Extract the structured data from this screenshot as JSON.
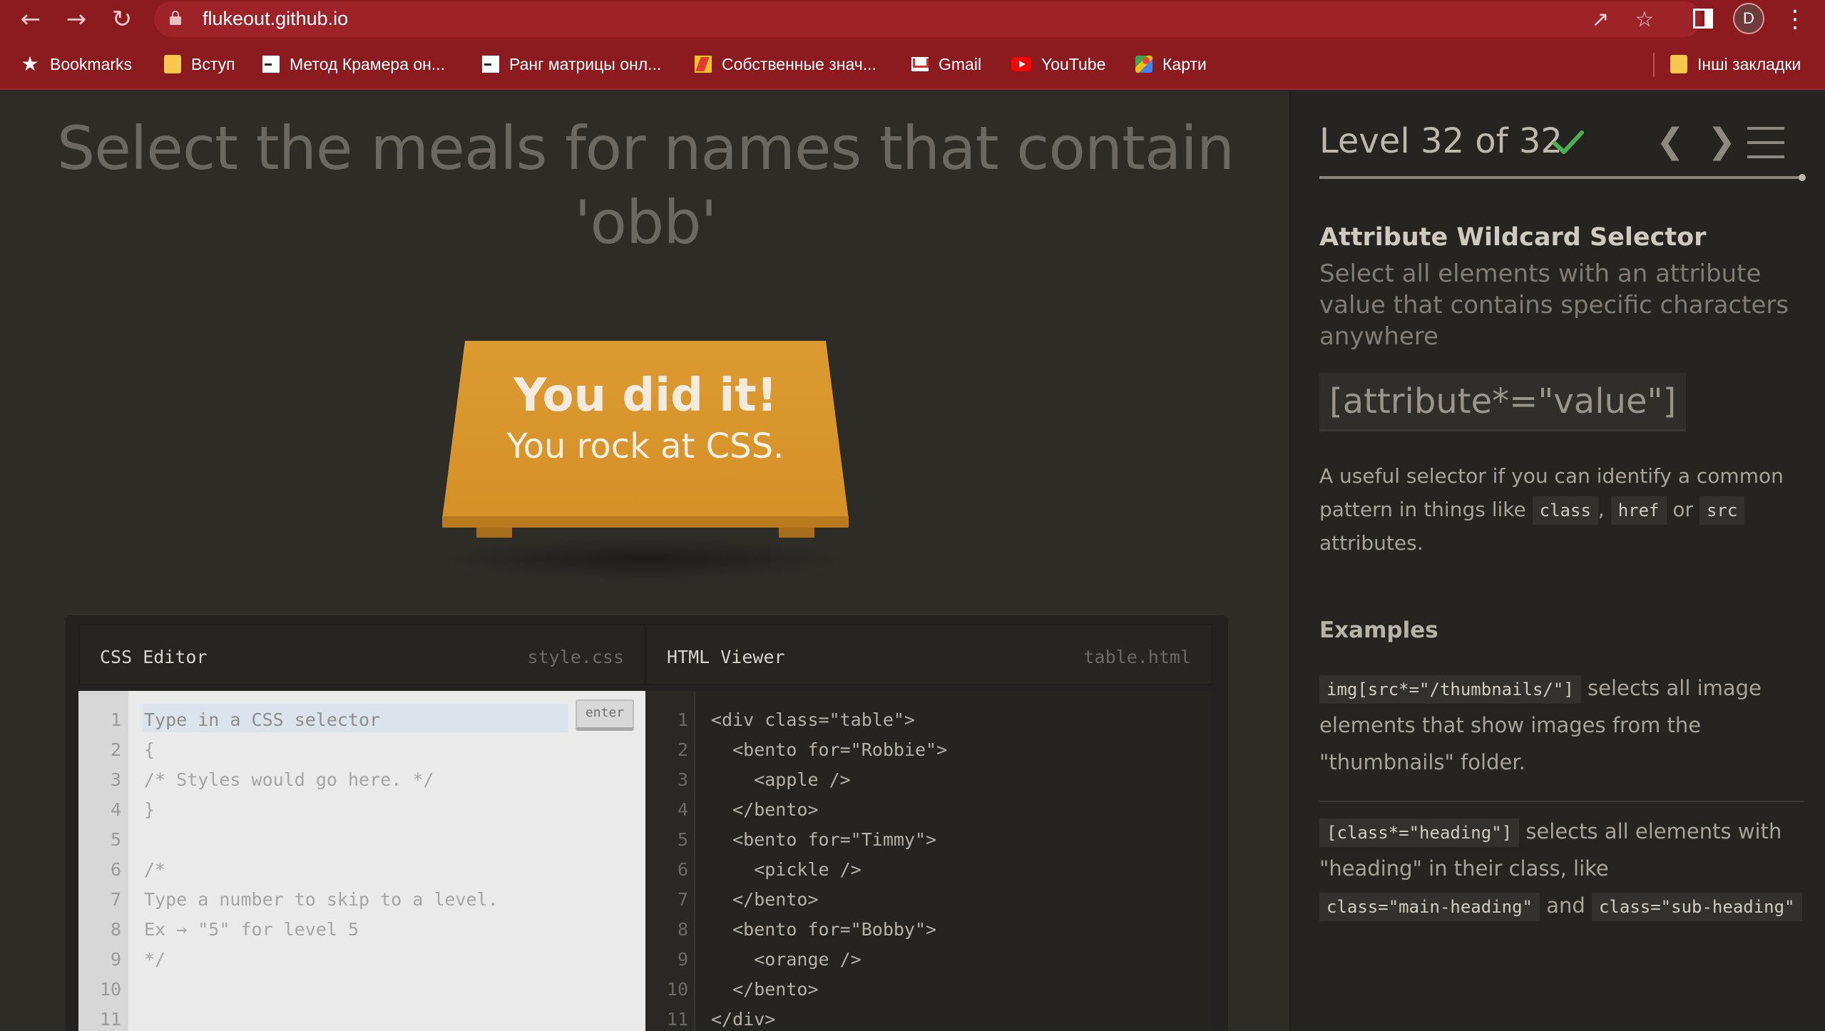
{
  "browser": {
    "url": "flukeout.github.io",
    "avatar_initial": "D",
    "bookmarks": [
      {
        "label": "Bookmarks",
        "icon": "star-icon"
      },
      {
        "label": "Вступ",
        "icon": "folder-icon"
      },
      {
        "label": "Метод Крамера он...",
        "icon": "page-icon"
      },
      {
        "label": "Ранг матрицы онл...",
        "icon": "page-icon"
      },
      {
        "label": "Собственные знач...",
        "icon": "bolt-icon"
      },
      {
        "label": "Gmail",
        "icon": "gmail-icon"
      },
      {
        "label": "YouTube",
        "icon": "youtube-icon"
      },
      {
        "label": "Карти",
        "icon": "maps-icon"
      }
    ],
    "other_bookmarks": "Інші закладки"
  },
  "game": {
    "order_line1": "Select the meals for names that contain",
    "order_line2": "'obb'",
    "win_title": "You did it!",
    "win_subtitle": "You rock at CSS."
  },
  "css_editor": {
    "title": "CSS Editor",
    "file": "style.css",
    "placeholder": "Type in a CSS selector",
    "enter_label": "enter",
    "line_numbers": [
      "1",
      "2",
      "3",
      "4",
      "5",
      "6",
      "7",
      "8",
      "9",
      "10",
      "11"
    ],
    "lines": [
      "",
      "{",
      "/* Styles would go here. */",
      "}",
      "",
      "/*",
      "Type a number to skip to a level.",
      "Ex → \"5\" for level 5",
      "*/",
      "",
      ""
    ]
  },
  "html_viewer": {
    "title": "HTML Viewer",
    "file": "table.html",
    "line_numbers": [
      "1",
      "2",
      "3",
      "4",
      "5",
      "6",
      "7",
      "8",
      "9",
      "10",
      "11"
    ],
    "lines": [
      "<div class=\"table\">",
      "  <bento for=\"Robbie\">",
      "    <apple />",
      "  </bento>",
      "  <bento for=\"Timmy\">",
      "    <pickle />",
      "  </bento>",
      "  <bento for=\"Bobby\">",
      "    <orange />",
      "  </bento>",
      "</div>"
    ]
  },
  "sidebar": {
    "level_text": "Level 32 of 32",
    "level_complete": true,
    "progress": 1.0,
    "selector_name": "Attribute Wildcard Selector",
    "selector_title": "Select all elements with an attribute value that contains specific characters anywhere",
    "syntax": "[attribute*=\"value\"]",
    "hint_part1": "A useful selector if you can identify a common pattern in things like",
    "hint_tag1": "class",
    "hint_sep1": ",",
    "hint_tag2": "href",
    "hint_or": "or",
    "hint_tag3": "src",
    "hint_part2": "attributes.",
    "examples_title": "Examples",
    "ex1_code": "img[src*=\"/thumbnails/\"]",
    "ex1_text": "selects all image elements that show images from the \"thumbnails\" folder.",
    "ex2_code": "[class*=\"heading\"]",
    "ex2_text": "selects all elements with \"heading\" in their class, like",
    "ex2_tag1": "class=\"main-heading\"",
    "ex2_and": "and",
    "ex2_tag2": "class=\"sub-heading\""
  },
  "colors": {
    "chrome": "#8b1b1f",
    "table": "#d69127",
    "check": "#4caf50"
  }
}
